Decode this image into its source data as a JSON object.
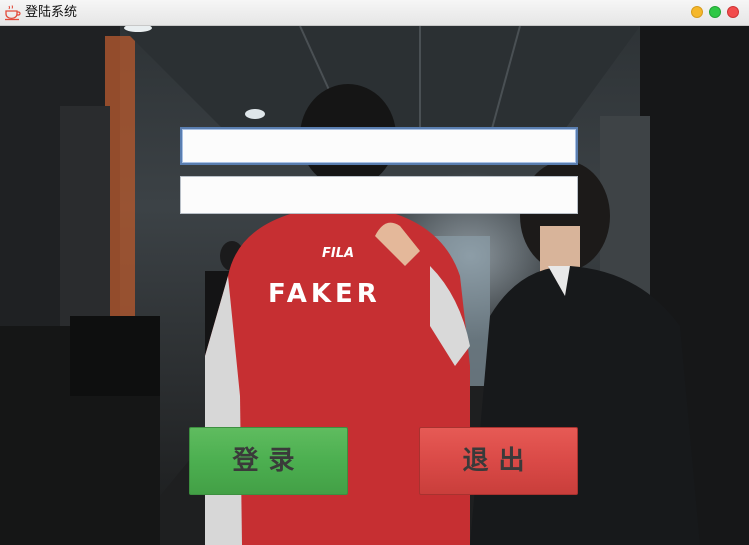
{
  "window": {
    "title": "登陆系统",
    "icon": "coffee-cup-icon"
  },
  "form": {
    "username_value": "",
    "password_value": ""
  },
  "buttons": {
    "login_label": "登录",
    "exit_label": "退出",
    "login_color": "#4caf50",
    "exit_color": "#da4a47"
  },
  "background": {
    "jacket_text_brand": "FILA",
    "jacket_text_name": "FAKER"
  }
}
